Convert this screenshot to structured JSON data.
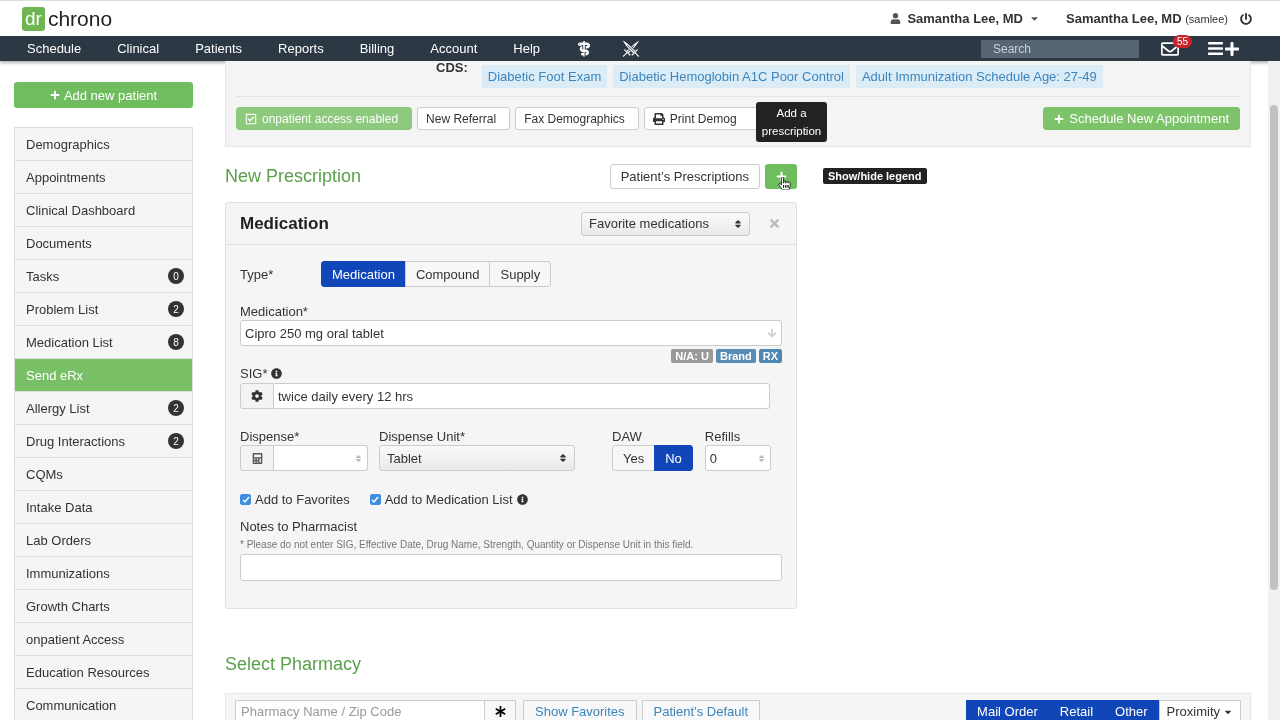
{
  "header": {
    "logo_mark": "dr",
    "logo_text": "chrono",
    "user_menu": "Samantha Lee, MD",
    "account_name": "Samantha Lee, MD",
    "account_username": "(samlee)"
  },
  "nav": {
    "items": [
      "Schedule",
      "Clinical",
      "Patients",
      "Reports",
      "Billing",
      "Account",
      "Help"
    ],
    "search": {
      "placeholder": "Search"
    },
    "messages_badge": "55"
  },
  "sidebar": {
    "add_button": "Add new patient",
    "items": [
      {
        "label": "Demographics",
        "selected": false
      },
      {
        "label": "Appointments",
        "selected": false
      },
      {
        "label": "Clinical Dashboard",
        "selected": false
      },
      {
        "label": "Documents",
        "selected": false
      },
      {
        "label": "Tasks",
        "badge": "0",
        "selected": false
      },
      {
        "label": "Problem List",
        "badge": "2",
        "selected": false
      },
      {
        "label": "Medication List",
        "badge": "8",
        "selected": false
      },
      {
        "label": "Send eRx",
        "selected": true
      },
      {
        "label": "Allergy List",
        "badge": "2",
        "selected": false
      },
      {
        "label": "Drug Interactions",
        "badge": "2",
        "selected": false
      },
      {
        "label": "CQMs",
        "selected": false
      },
      {
        "label": "Intake Data",
        "selected": false
      },
      {
        "label": "Lab Orders",
        "selected": false
      },
      {
        "label": "Immunizations",
        "selected": false
      },
      {
        "label": "Growth Charts",
        "selected": false
      },
      {
        "label": "onpatient Access",
        "selected": false
      },
      {
        "label": "Education Resources",
        "selected": false
      },
      {
        "label": "Communication",
        "selected": false
      }
    ]
  },
  "patient_panel": {
    "cds_label": "CDS:",
    "cds_tags": [
      "Diabetic Foot Exam",
      "Diabetic Hemoglobin A1C Poor Control",
      "Adult Immunization Schedule Age: 27-49"
    ],
    "actions": [
      {
        "kind": "access",
        "label": "onpatient access enabled"
      },
      {
        "kind": "plain",
        "label": "New Referral"
      },
      {
        "kind": "plain",
        "label": "Fax Demographics"
      },
      {
        "kind": "print",
        "label": "Print Demog"
      }
    ],
    "schedule_button": "Schedule New Appointment"
  },
  "tooltip": "Add a prescription",
  "prescription": {
    "title": "New Prescription",
    "history_button": "Patient’s Prescriptions",
    "legend_tip": "Show/hide legend",
    "card": {
      "title": "Medication",
      "favorites_select": "Favorite medications",
      "type_label": "Type*",
      "type_options": [
        {
          "label": "Medication",
          "selected": true
        },
        {
          "label": "Compound",
          "selected": false
        },
        {
          "label": "Supply",
          "selected": false
        }
      ],
      "medication_label": "Medication*",
      "medication_value": "Cipro 250 mg oral tablet",
      "medication_tags": [
        {
          "label": "N/A: U",
          "color": "#9a9a9a"
        },
        {
          "label": "Brand",
          "color": "#5a8db3"
        },
        {
          "label": "RX",
          "color": "#4e88b0"
        }
      ],
      "sig_label": "SIG*",
      "sig_value": "twice daily every 12 hrs",
      "dispense_label": "Dispense*",
      "dispense_unit_label": "Dispense Unit*",
      "dispense_unit_value": "Tablet",
      "daw_label": "DAW",
      "daw_options": [
        {
          "label": "Yes",
          "selected": false
        },
        {
          "label": "No",
          "selected": true
        }
      ],
      "refills_label": "Refills",
      "refills_value": "0",
      "checkboxes": [
        {
          "label": "Add to Favorites",
          "checked": true,
          "info": false
        },
        {
          "label": "Add to Medication List",
          "checked": true,
          "info": true
        }
      ],
      "notes_label": "Notes to Pharmacist",
      "notes_hint": "* Please do not enter SIG, Effective Date, Drug Name, Strength, Quantity or Dispense Unit in this field."
    }
  },
  "pharmacy": {
    "title": "Select Pharmacy",
    "search": {
      "placeholder": "Pharmacy Name / Zip Code"
    },
    "links": [
      "Show Favorites",
      "Patient’s Default"
    ],
    "filters": [
      {
        "label": "Mail Order",
        "selected": true
      },
      {
        "label": "Retail",
        "selected": true
      },
      {
        "label": "Other",
        "selected": true
      }
    ],
    "sort": "Proximity"
  }
}
